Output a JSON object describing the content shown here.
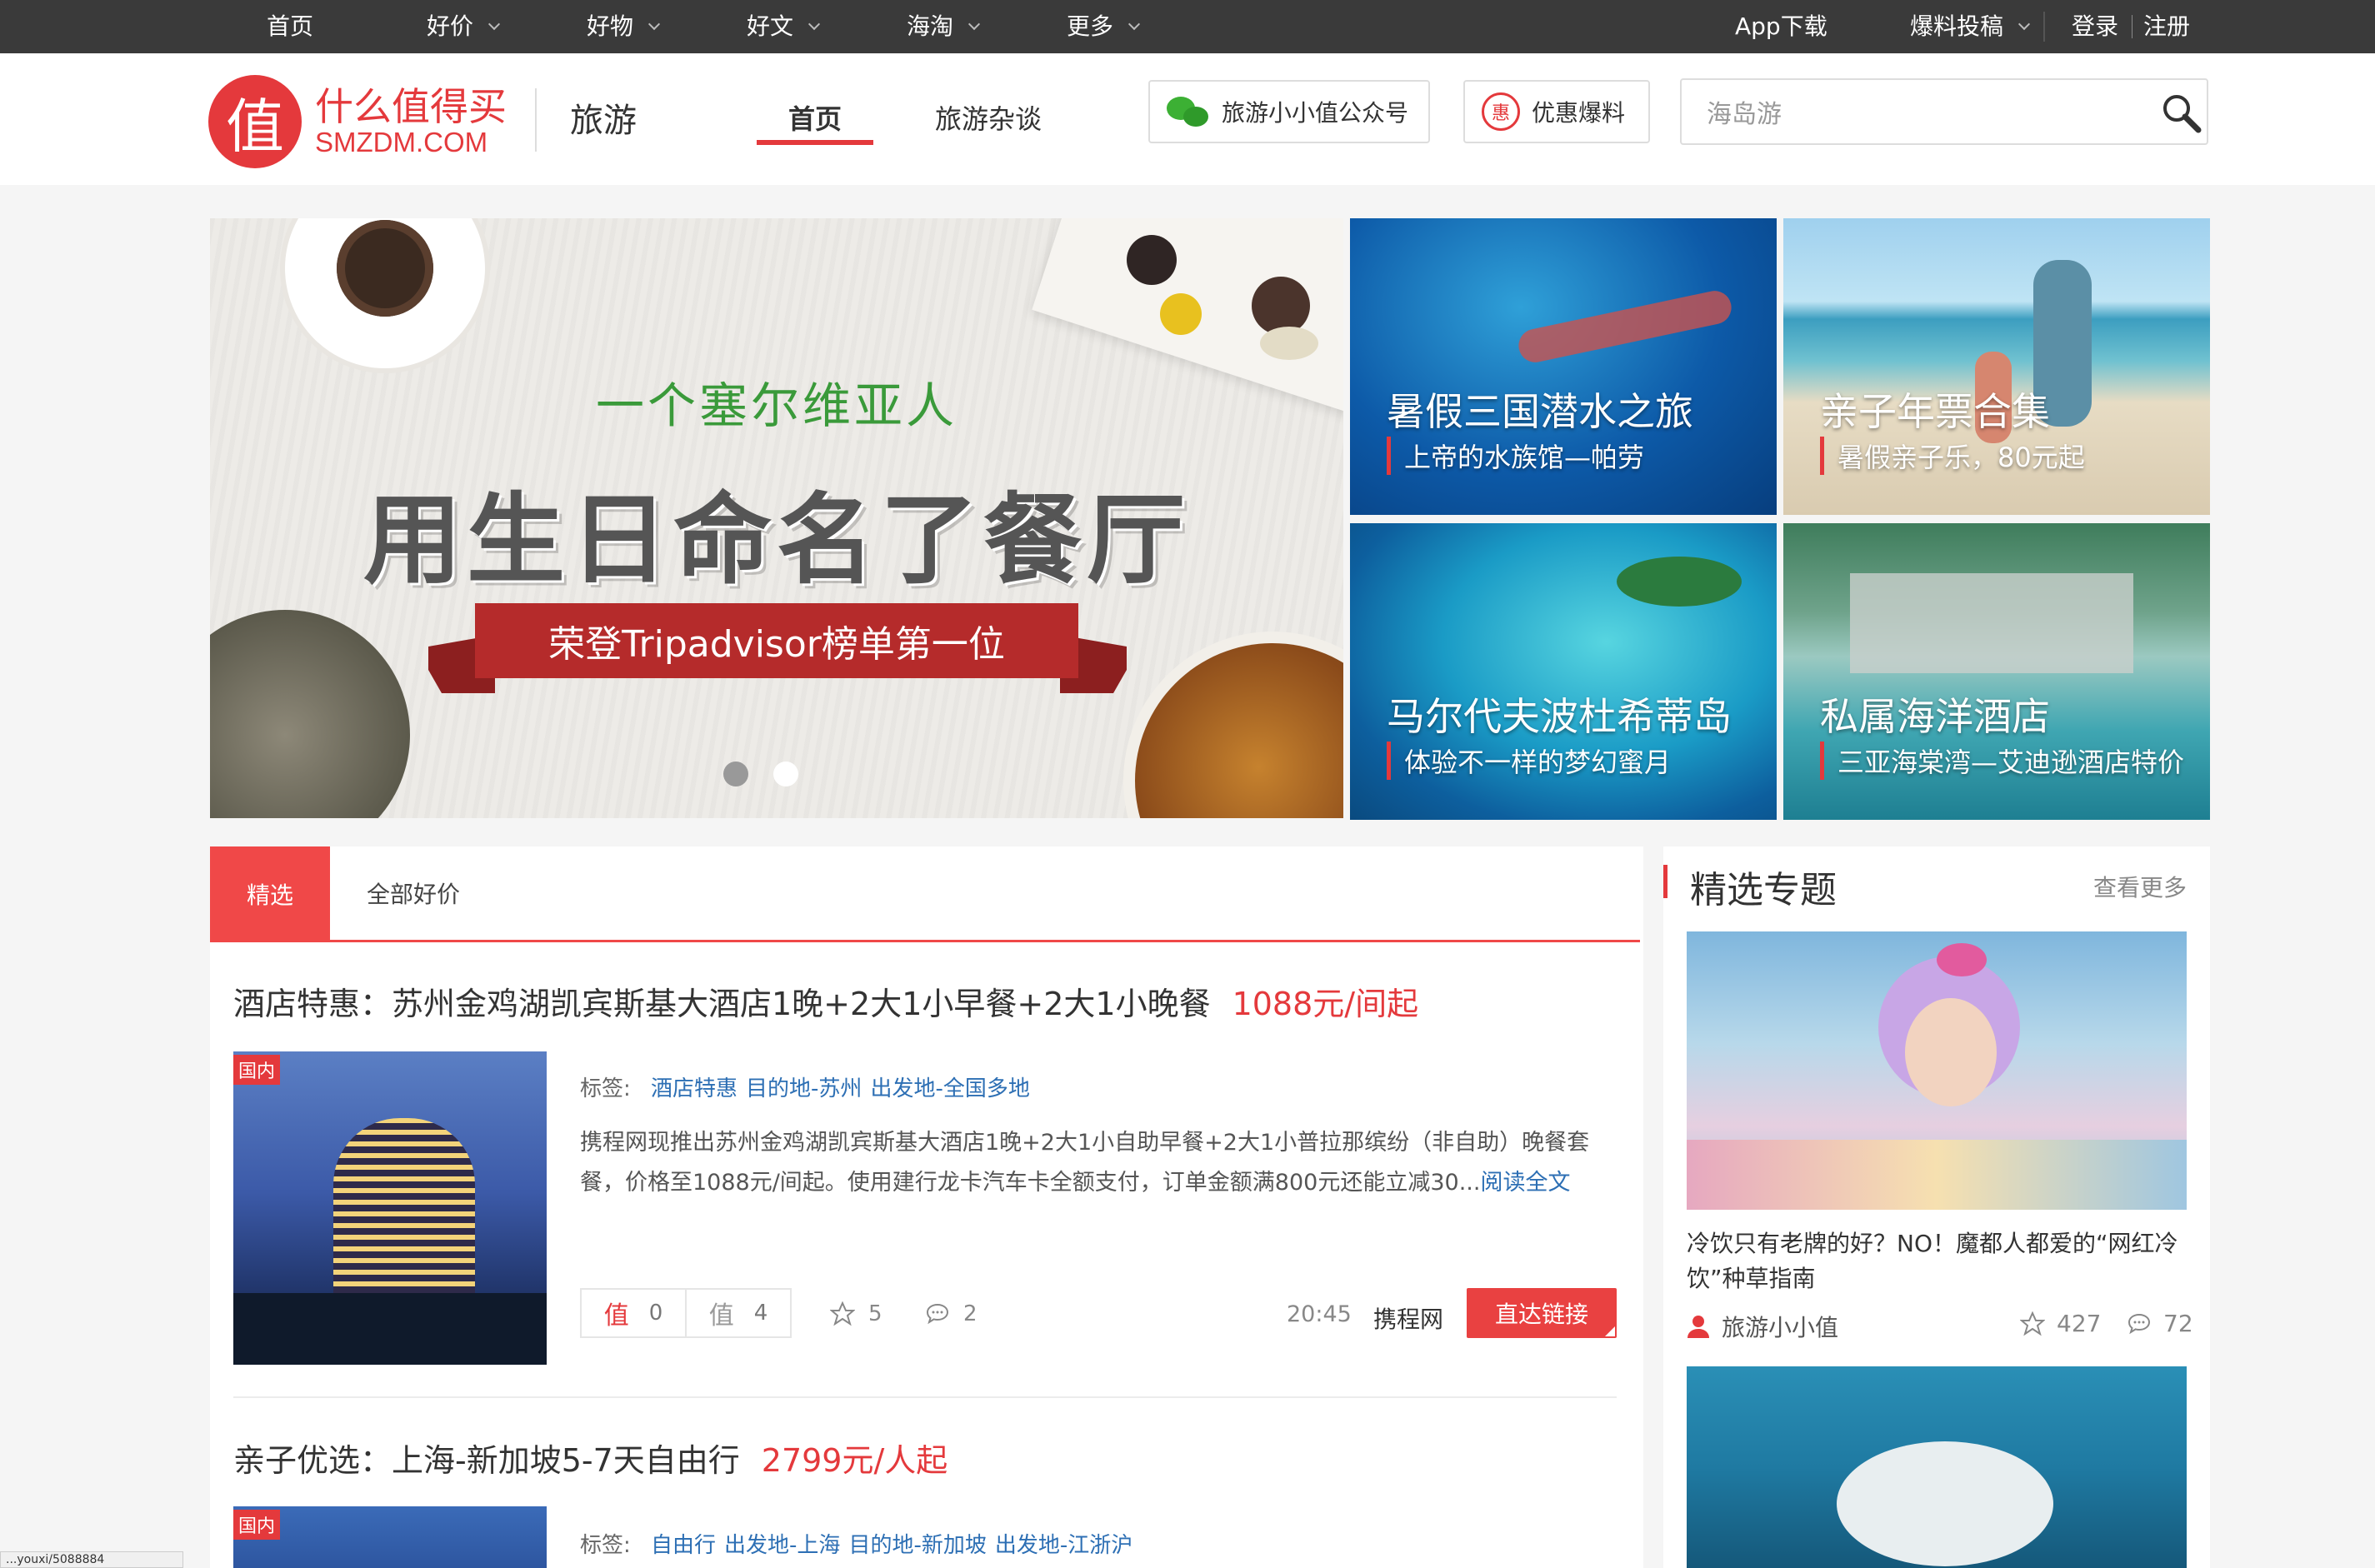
{
  "topnav": {
    "items": [
      {
        "label": "首页"
      },
      {
        "label": "好价"
      },
      {
        "label": "好物"
      },
      {
        "label": "好文"
      },
      {
        "label": "海淘"
      },
      {
        "label": "更多"
      }
    ],
    "app_download": "App下载",
    "submit": "爆料投稿",
    "login": "登录",
    "register": "注册"
  },
  "header": {
    "logo_cn": "什么值得买",
    "logo_en": "SMZDM.COM",
    "logo_mark": "值",
    "channel": "旅游",
    "tabs": [
      {
        "label": "首页"
      },
      {
        "label": "旅游杂谈"
      }
    ],
    "wechat_button": "旅游小小值公众号",
    "promo_button": "优惠爆料",
    "promo_icon_char": "惠",
    "search_value": "海岛游"
  },
  "banner": {
    "subtitle": "一个塞尔维亚人",
    "title": "用生日命名了餐厅",
    "ribbon": "荣登Tripadvisor榜单第一位"
  },
  "tiles": [
    {
      "title": "暑假三国潜水之旅",
      "sub": "上帝的水族馆—帕劳"
    },
    {
      "title": "亲子年票合集",
      "sub": "暑假亲子乐，80元起"
    },
    {
      "title": "马尔代夫波杜希蒂岛",
      "sub": "体验不一样的梦幻蜜月"
    },
    {
      "title": "私属海洋酒店",
      "sub": "三亚海棠湾—艾迪逊酒店特价"
    }
  ],
  "list": {
    "tab_selected": "精选",
    "tab_all": "全部好价",
    "deals": [
      {
        "title": "酒店特惠：苏州金鸡湖凯宾斯基大酒店1晚+2大1小早餐+2大1小晚餐",
        "price": "1088元/间起",
        "badge": "国内",
        "tags_label": "标签:",
        "tags": [
          "酒店特惠",
          "目的地-苏州",
          "出发地-全国多地"
        ],
        "desc": "携程网现推出苏州金鸡湖凯宾斯基大酒店1晚+2大1小自助早餐+2大1小普拉那缤纷（非自助）晚餐套餐，价格至1088元/间起。使用建行龙卡汽车卡全额支付，订单金额满800元还能立减30...",
        "read_more": "阅读全文",
        "zhi_icon": "值",
        "zhi": "0",
        "buzhi_icon": "值",
        "buzhi": "4",
        "stars": "5",
        "comments": "2",
        "time": "20:45",
        "source": "携程网",
        "button": "直达链接"
      },
      {
        "title": "亲子优选：上海-新加坡5-7天自由行",
        "price": "2799元/人起",
        "badge": "国内",
        "tags_label": "标签:",
        "tags": [
          "自由行",
          "出发地-上海",
          "目的地-新加坡",
          "出发地-江浙沪"
        ]
      }
    ]
  },
  "sidebar": {
    "title": "精选专题",
    "more": "查看更多",
    "caption": "冷饮只有老牌的好？NO！魔都人都爱的“网红冷饮”种草指南",
    "author": "旅游小小值",
    "stars": "427",
    "comments": "72"
  },
  "statusbar": "...youxi/5088884"
}
